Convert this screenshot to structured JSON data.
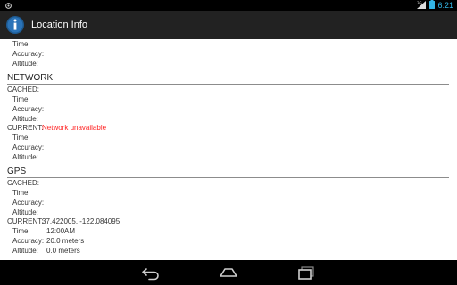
{
  "status_bar": {
    "time": "6:21",
    "signal_label": "3G",
    "left_icon": "android-debug-icon",
    "icons": [
      "signal-icon",
      "battery-icon"
    ]
  },
  "action_bar": {
    "title": "Location Info",
    "icon": "info-app-icon"
  },
  "top_partial": {
    "time_label": "Time:",
    "accuracy_label": "Accuracy:",
    "altitude_label": "Altitude:"
  },
  "network": {
    "title": "NETWORK",
    "cached": {
      "label": "CACHED:",
      "time_label": "Time:",
      "accuracy_label": "Accuracy:",
      "altitude_label": "Altitude:"
    },
    "current": {
      "label": "CURRENT:",
      "value": "Network unavailable",
      "time_label": "Time:",
      "accuracy_label": "Accuracy:",
      "altitude_label": "Altitude:"
    }
  },
  "gps": {
    "title": "GPS",
    "cached": {
      "label": "CACHED:",
      "time_label": "Time:",
      "accuracy_label": "Accuracy:",
      "altitude_label": "Altitude:"
    },
    "current": {
      "label": "CURRENT:",
      "value": "37.422005, -122.084095",
      "time_label": "Time:",
      "time_value": "12:00AM",
      "accuracy_label": "Accuracy:",
      "accuracy_value": "20.0 meters",
      "altitude_label": "Altitude:",
      "altitude_value": "0.0 meters"
    }
  },
  "nav_bar": {
    "icons": [
      "back-icon",
      "home-icon",
      "recent-apps-icon"
    ]
  },
  "colors": {
    "accent": "#33b5e5",
    "error": "#ff2222",
    "action_bar_bg": "#222222"
  }
}
